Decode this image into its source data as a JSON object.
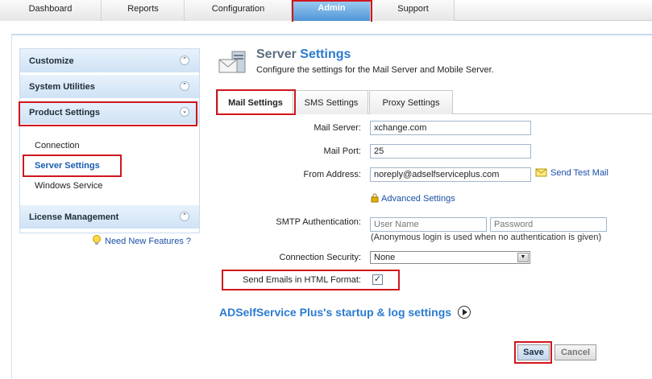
{
  "topnav": {
    "tabs": [
      {
        "label": "Dashboard"
      },
      {
        "label": "Reports"
      },
      {
        "label": "Configuration"
      },
      {
        "label": "Admin"
      },
      {
        "label": "Support"
      }
    ]
  },
  "sidebar": {
    "sections": [
      {
        "label": "Customize"
      },
      {
        "label": "System Utilities"
      },
      {
        "label": "Product Settings"
      },
      {
        "label": "License Management"
      }
    ],
    "product_items": [
      {
        "label": "Connection"
      },
      {
        "label": "Server Settings"
      },
      {
        "label": "Windows Service"
      }
    ],
    "need_features": "Need New Features ?"
  },
  "header": {
    "title_a": "Server",
    "title_b": "Settings",
    "subtitle": "Configure the settings for the Mail Server and Mobile Server."
  },
  "subtabs": [
    {
      "label": "Mail Settings"
    },
    {
      "label": "SMS Settings"
    },
    {
      "label": "Proxy Settings"
    }
  ],
  "form": {
    "mail_server_label": "Mail Server:",
    "mail_server_value": "xchange.com",
    "mail_port_label": "Mail Port:",
    "mail_port_value": "25",
    "from_label": "From Address:",
    "from_value": "noreply@adselfserviceplus.com",
    "send_test_mail": "Send Test Mail",
    "advanced": "Advanced Settings",
    "smtp_label": "SMTP Authentication:",
    "username_placeholder": "User Name",
    "password_placeholder": "Password",
    "anon_hint": "(Anonymous login is used when no authentication is given)",
    "security_label": "Connection Security:",
    "security_value": "None",
    "html_label": "Send Emails in HTML Format:",
    "html_checked": true
  },
  "startup_link": "ADSelfService Plus's startup & log settings",
  "buttons": {
    "save": "Save",
    "cancel": "Cancel"
  }
}
